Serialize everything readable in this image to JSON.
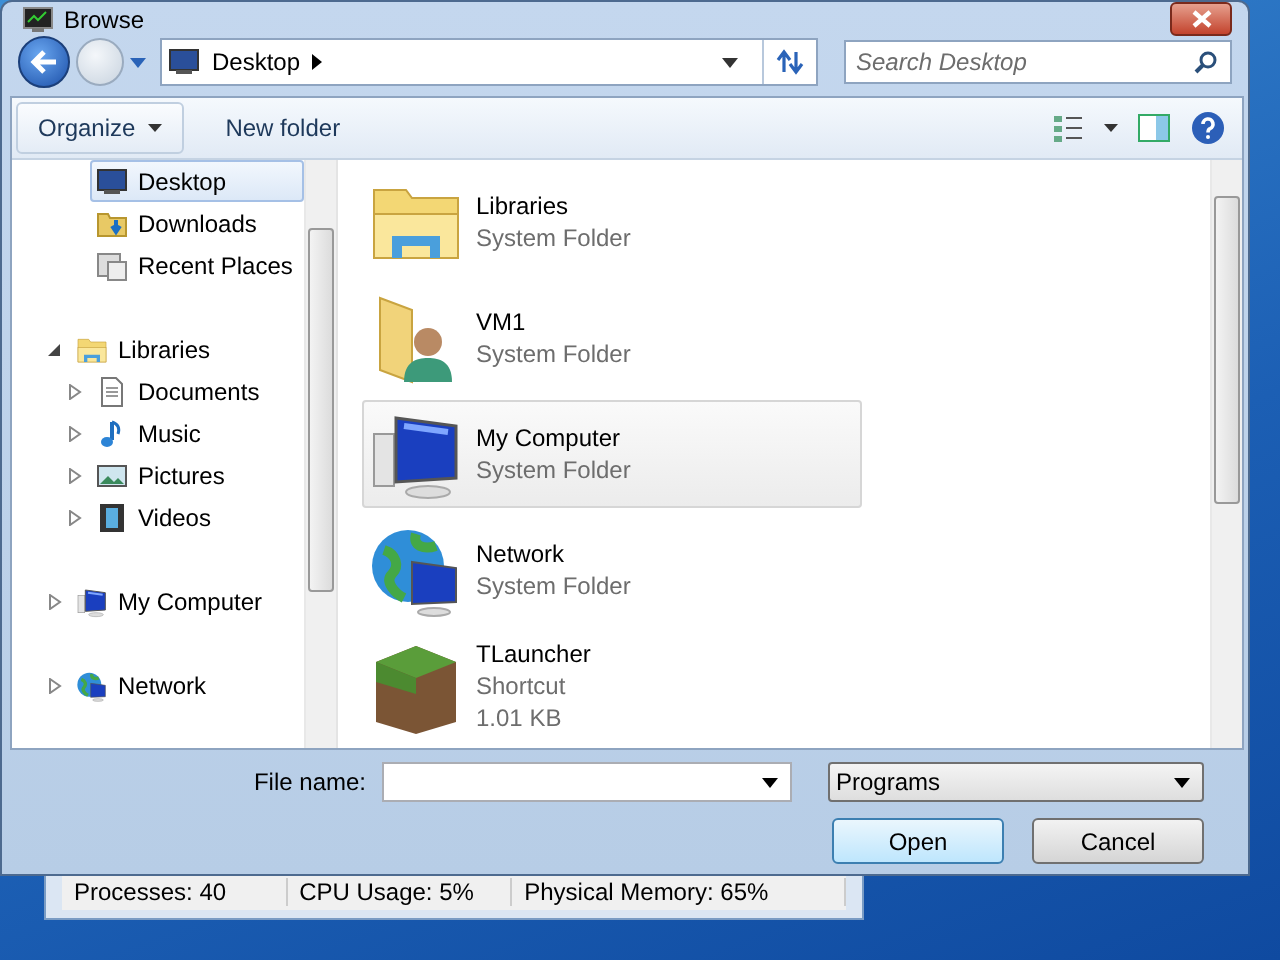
{
  "background_window": {
    "status_bar": [
      "Processes: 40",
      "CPU Usage: 5%",
      "Physical Memory: 65%"
    ]
  },
  "window": {
    "title": "Browse"
  },
  "address_bar": {
    "location": "Desktop"
  },
  "search": {
    "placeholder": "Search Desktop"
  },
  "toolbar": {
    "organize": "Organize",
    "new_folder": "New folder"
  },
  "navigation": [
    {
      "items": [
        {
          "label": "Desktop",
          "kind": "desktop",
          "selected": true
        },
        {
          "label": "Downloads",
          "kind": "downloads",
          "selected": false
        },
        {
          "label": "Recent Places",
          "kind": "recent",
          "selected": false
        }
      ]
    },
    {
      "items": [
        {
          "label": "Libraries",
          "kind": "libraries",
          "selected": false,
          "expanded": true,
          "children": [
            {
              "label": "Documents",
              "kind": "documents",
              "selected": false,
              "expanded": false
            },
            {
              "label": "Music",
              "kind": "music",
              "selected": false,
              "expanded": false
            },
            {
              "label": "Pictures",
              "kind": "pictures",
              "selected": false,
              "expanded": false
            },
            {
              "label": "Videos",
              "kind": "videos",
              "selected": false,
              "expanded": false
            }
          ]
        }
      ]
    },
    {
      "items": [
        {
          "label": "My Computer",
          "kind": "computer",
          "selected": false,
          "expanded": false
        }
      ]
    },
    {
      "items": [
        {
          "label": "Network",
          "kind": "network",
          "selected": false,
          "expanded": false
        }
      ]
    }
  ],
  "files": [
    {
      "name": "Libraries",
      "type": "System Folder",
      "kind": "libraries",
      "selected": false
    },
    {
      "name": "VM1",
      "type": "System Folder",
      "kind": "user",
      "selected": false
    },
    {
      "name": "My Computer",
      "type": "System Folder",
      "kind": "computer",
      "selected": true
    },
    {
      "name": "Network",
      "type": "System Folder",
      "kind": "network",
      "selected": false
    },
    {
      "name": "TLauncher",
      "type": "Shortcut",
      "size": "1.01 KB",
      "kind": "shortcut",
      "selected": false
    }
  ],
  "file_name": {
    "label": "File name:"
  },
  "file_type": {
    "value": "Programs"
  },
  "buttons": [
    {
      "label": "Open",
      "default": true
    },
    {
      "label": "Cancel",
      "default": false
    }
  ]
}
